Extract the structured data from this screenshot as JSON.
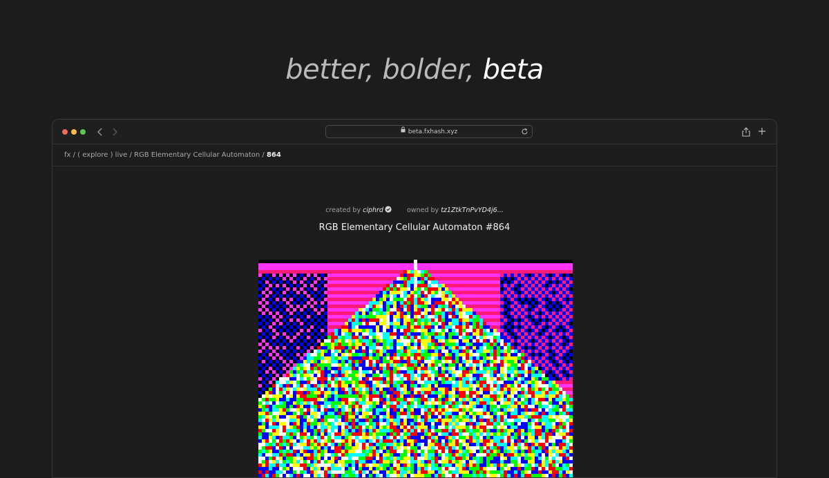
{
  "headline": {
    "part1": "better, bolder, ",
    "part2": "beta"
  },
  "browser": {
    "traffic_lights": {
      "red": "#ee6a5f",
      "yellow": "#f5bd4f",
      "green": "#61c454"
    },
    "url": "beta.fxhash.xyz",
    "icons": [
      "chevron-left-icon",
      "chevron-right-icon",
      "lock-icon",
      "reload-icon",
      "share-icon",
      "plus-icon"
    ]
  },
  "breadcrumb": {
    "path": "fx / ( explore ) live / RGB Elementary Cellular Automaton / ",
    "current": "864"
  },
  "token": {
    "created_label": "created by",
    "creator": "ciphrd",
    "owned_label": "owned by",
    "owner": "tz1ZtkTnPvYD4j6...",
    "title": "RGB Elementary Cellular Automaton #864"
  },
  "colors": {
    "background": "#1c1c1c",
    "artwork_palette": [
      "#ff1a7a",
      "#ff33ff",
      "#000000",
      "#0000ff",
      "#00ff00",
      "#ffff00",
      "#00ffff",
      "#ffffff",
      "#ff0000"
    ]
  }
}
